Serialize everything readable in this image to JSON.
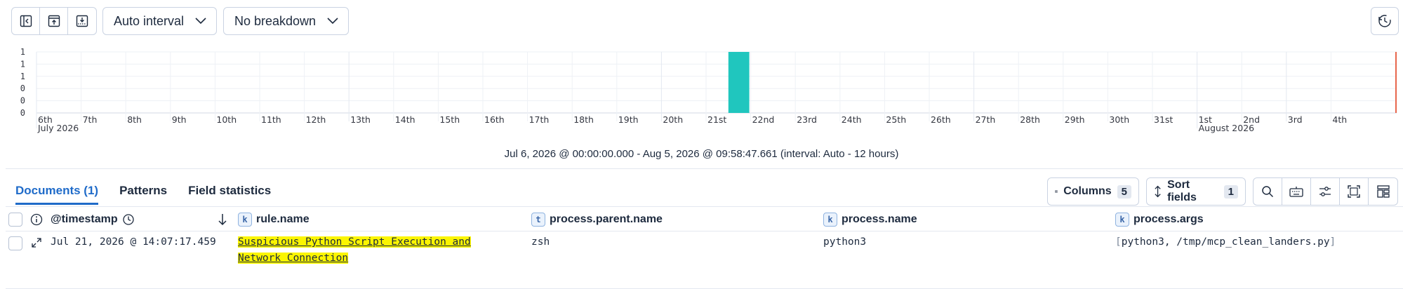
{
  "toolbar": {
    "icon_buttons": [
      {
        "icon": "collapse-sidebar-icon"
      },
      {
        "icon": "browser-upload-icon"
      },
      {
        "icon": "table-download-icon"
      }
    ],
    "interval_select": "Auto interval",
    "breakdown_select": "No breakdown",
    "corner_icon": "reset-icon"
  },
  "histogram": {
    "summary": "Jul 6, 2026 @ 00:00:00.000 - Aug 5, 2026 @ 09:58:47.661 (interval: Auto - 12 hours)"
  },
  "chart_data": {
    "type": "bar",
    "y_tick_labels": [
      "1",
      "1",
      "1",
      "0",
      "0",
      "0"
    ],
    "x_tick_labels": [
      "6th",
      "7th",
      "8th",
      "9th",
      "10th",
      "11th",
      "12th",
      "13th",
      "14th",
      "15th",
      "16th",
      "17th",
      "18th",
      "19th",
      "20th",
      "21st",
      "22nd",
      "23rd",
      "24th",
      "25th",
      "26th",
      "27th",
      "28th",
      "29th",
      "30th",
      "31st",
      "1st",
      "2nd",
      "3rd",
      "4th"
    ],
    "month_labels": [
      {
        "label": "July 2026",
        "at": "6th"
      },
      {
        "label": "August 2026",
        "at": "1st"
      }
    ],
    "bars": [
      {
        "x": "2026-07-21T12:00",
        "count": 1
      }
    ],
    "ylim": [
      0,
      1
    ],
    "bar_color": "#20c6be",
    "now_marker_color": "#e7664c",
    "grid": true
  },
  "tabs": [
    {
      "label": "Documents (1)",
      "active": true
    },
    {
      "label": "Patterns",
      "active": false
    },
    {
      "label": "Field statistics",
      "active": false
    }
  ],
  "table_tools": {
    "columns_label": "Columns",
    "columns_count": "5",
    "sort_label": "Sort fields",
    "sort_count": "1",
    "icons": [
      "search-icon",
      "keyboard-icon",
      "display-settings-icon",
      "fullscreen-icon",
      "layout-icon"
    ]
  },
  "columns": {
    "timestamp": "@timestamp",
    "rule_name": {
      "type": "k",
      "label": "rule.name"
    },
    "parent_name": {
      "type": "t",
      "label": "process.parent.name"
    },
    "process_name": {
      "type": "k",
      "label": "process.name"
    },
    "process_args": {
      "type": "k",
      "label": "process.args"
    }
  },
  "rows": [
    {
      "timestamp": "Jul 21, 2026 @ 14:07:17.459",
      "rule_name_line1": "Suspicious Python Script Execution and",
      "rule_name_line2": "Network Connection",
      "parent_name": "zsh",
      "process_name": "python3",
      "args_open": "[",
      "args_value": "python3, /tmp/mcp_clean_landers.py",
      "args_close": "]"
    }
  ]
}
